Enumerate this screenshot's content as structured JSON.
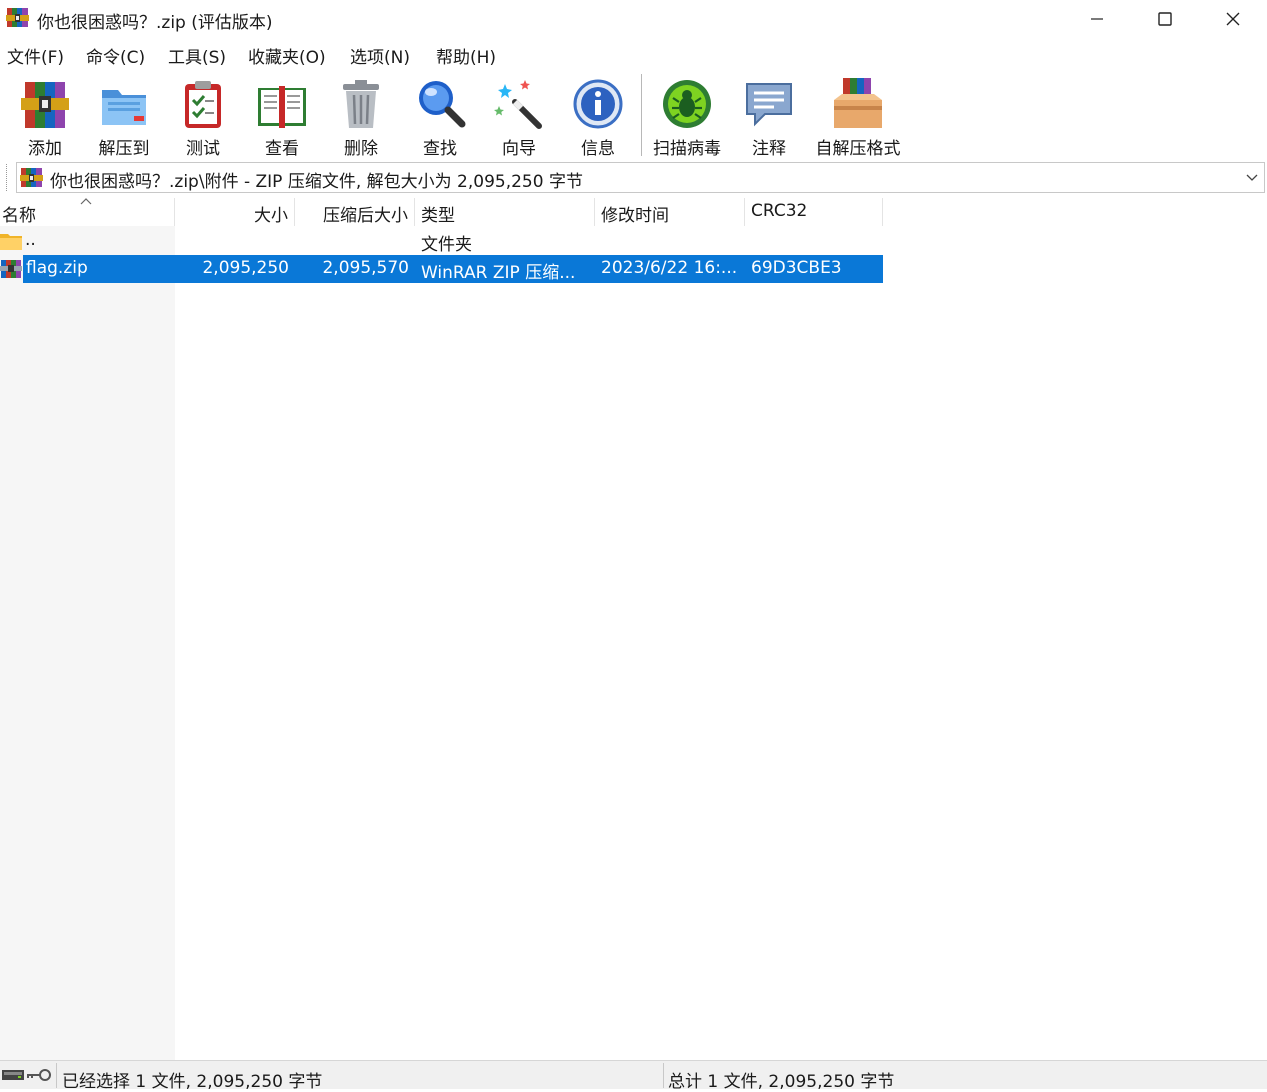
{
  "window": {
    "title": "你也很困惑吗？.zip (评估版本)",
    "icon": "winrar-icon"
  },
  "menu": [
    {
      "label": "文件(F)"
    },
    {
      "label": "命令(C)"
    },
    {
      "label": "工具(S)"
    },
    {
      "label": "收藏夹(O)"
    },
    {
      "label": "选项(N)"
    },
    {
      "label": "帮助(H)"
    }
  ],
  "toolbar": [
    {
      "label": "添加",
      "icon": "add-archive-icon"
    },
    {
      "label": "解压到",
      "icon": "extract-to-icon"
    },
    {
      "label": "测试",
      "icon": "test-clipboard-icon"
    },
    {
      "label": "查看",
      "icon": "view-book-icon"
    },
    {
      "label": "删除",
      "icon": "trash-icon"
    },
    {
      "label": "查找",
      "icon": "magnifier-icon"
    },
    {
      "label": "向导",
      "icon": "wizard-wand-icon"
    },
    {
      "label": "信息",
      "icon": "info-icon"
    },
    {
      "label": "扫描病毒",
      "icon": "virus-scan-bug-icon"
    },
    {
      "label": "注释",
      "icon": "comment-bubble-icon"
    },
    {
      "label": "自解压格式",
      "icon": "sfx-box-icon"
    }
  ],
  "address": {
    "path": "你也很困惑吗？.zip\\附件 - ZIP 压缩文件, 解包大小为 2,095,250 字节"
  },
  "columns": {
    "name": "名称",
    "size": "大小",
    "packed": "压缩后大小",
    "type": "类型",
    "modified": "修改时间",
    "crc": "CRC32"
  },
  "rows": [
    {
      "name": "..",
      "size": "",
      "packed": "",
      "type": "文件夹",
      "modified": "",
      "crc": "",
      "icon": "folder-icon",
      "selected": false
    },
    {
      "name": "flag.zip",
      "size": "2,095,250",
      "packed": "2,095,570",
      "type": "WinRAR ZIP 压缩...",
      "modified": "2023/6/22 16:...",
      "crc": "69D3CBE3",
      "icon": "zip-file-icon",
      "selected": true
    }
  ],
  "status": {
    "left": "已经选择 1 文件, 2,095,250 字节",
    "right": "总计 1 文件, 2,095,250 字节"
  },
  "colors": {
    "selection": "#0a78d7",
    "name_pane": "#f6f6f6",
    "status_bg": "#f0f0f0"
  }
}
